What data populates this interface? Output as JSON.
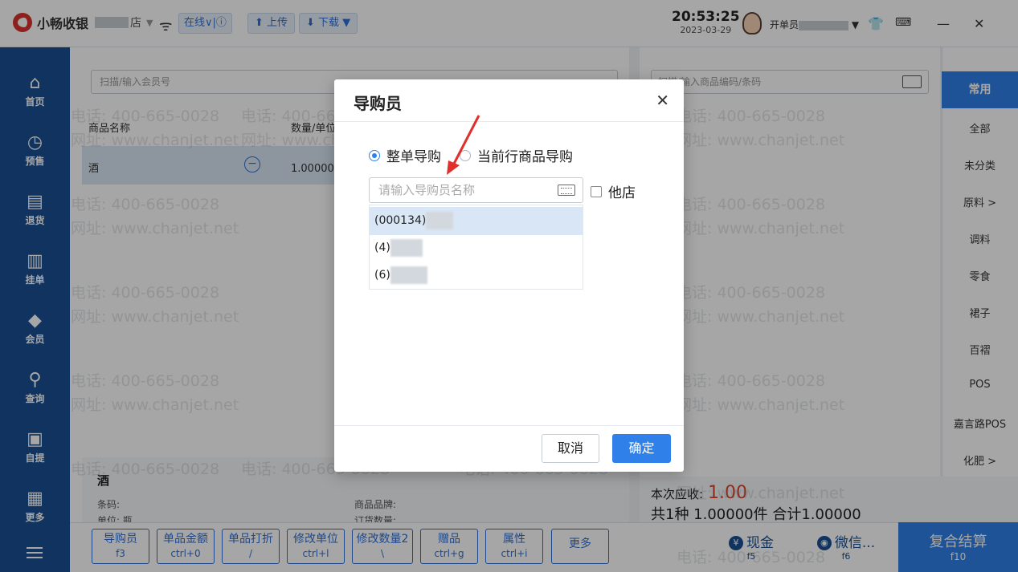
{
  "app": {
    "logo_text": "小畅收银",
    "store_suffix": "店",
    "online_label": "在线∨|ⓘ",
    "upload_label": "上传",
    "download_label": "下载 ▼",
    "time": "20:53:25",
    "date": "2023-03-29",
    "operator_prefix": "开单员"
  },
  "sidebar": {
    "items": [
      {
        "label": "首页",
        "icon": "home-icon",
        "glyph": "⌂"
      },
      {
        "label": "预售",
        "icon": "clock-icon",
        "glyph": "◷"
      },
      {
        "label": "退货",
        "icon": "return-icon",
        "glyph": "▤"
      },
      {
        "label": "挂单",
        "icon": "hold-order-icon",
        "glyph": "▥"
      },
      {
        "label": "会员",
        "icon": "diamond-icon",
        "glyph": "◆"
      },
      {
        "label": "查询",
        "icon": "search-icon",
        "glyph": "⚲"
      },
      {
        "label": "自提",
        "icon": "bag-icon",
        "glyph": "▣"
      },
      {
        "label": "更多",
        "icon": "grid-icon",
        "glyph": "▦"
      }
    ]
  },
  "main": {
    "member_placeholder": "扫描/输入会员号",
    "col_product": "商品名称",
    "col_qty": "数量/单位",
    "cart_item_name": "酒",
    "cart_item_qty": "1.00000瓶",
    "detail_name": "酒",
    "detail_barcode_label": "条码:",
    "detail_brand_label": "商品品牌:",
    "detail_unit_label": "单位:  瓶",
    "detail_stock_label": "订货数量:",
    "product_placeholder": "扫描/输入商品编码/条码"
  },
  "categories": {
    "active": "常用",
    "items": [
      "全部",
      "未分类",
      "原料 >",
      "调料",
      "零食",
      "裙子",
      "百褶",
      "POS",
      "嘉言路POS",
      "化肥 >"
    ]
  },
  "summary": {
    "due_label": "本次应收:",
    "due_amount": "1.00",
    "totals_text": "共1种 1.00000件 合计1.00000"
  },
  "toolbar": {
    "buttons": [
      {
        "label": "导购员",
        "key": "f3"
      },
      {
        "label": "单品金额",
        "key": "ctrl+0"
      },
      {
        "label": "单品打折",
        "key": "/"
      },
      {
        "label": "修改单位",
        "key": "ctrl+l"
      },
      {
        "label": "修改数量2",
        "key": "\\"
      },
      {
        "label": "赠品",
        "key": "ctrl+g"
      },
      {
        "label": "属性",
        "key": "ctrl+i"
      },
      {
        "label": "更多",
        "key": ""
      }
    ],
    "cash_label": "现金",
    "cash_key": "f5",
    "wechat_label": "微信...",
    "wechat_key": "f6",
    "checkout_label": "复合结算",
    "checkout_key": "f10"
  },
  "watermark": {
    "phone": "电话: 400-665-0028",
    "site": "网址: www.chanjet.net"
  },
  "dialog": {
    "title": "导购员",
    "radio_whole": "整单导购",
    "radio_current": "当前行商品导购",
    "search_placeholder": "请输入导购员名称",
    "other_store_label": "他店",
    "list": [
      "(000134)",
      "(4)",
      "(6)"
    ],
    "cancel_label": "取消",
    "ok_label": "确定"
  },
  "colors": {
    "sidebar": "#1a4f93",
    "primary": "#2f80e8",
    "amount": "#e0442b",
    "annotation_arrow": "#e0302b"
  }
}
